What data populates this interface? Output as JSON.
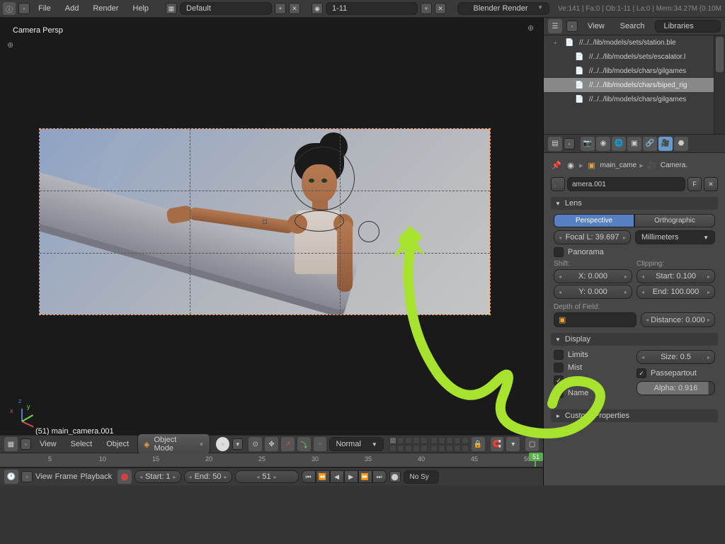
{
  "topbar": {
    "menus": [
      "File",
      "Add",
      "Render",
      "Help"
    ],
    "layout": "Default",
    "scene": "1-11",
    "renderer": "Blender Render",
    "stats": "Ve:141 | Fa:0 | Ob:1-11 | La:0 | Mem:34.27M (0.10M"
  },
  "viewport": {
    "persp_label": "Camera Persp",
    "object_label": "(51) main_camera.001",
    "header": {
      "menus": [
        "View",
        "Select",
        "Object"
      ],
      "mode": "Object Mode",
      "orientation": "Normal"
    }
  },
  "timeline": {
    "ticks": [
      5,
      10,
      15,
      20,
      25,
      30,
      35,
      40,
      45,
      50
    ],
    "current": 51,
    "footer": {
      "menus": [
        "View",
        "Frame",
        "Playback"
      ],
      "start_label": "Start: 1",
      "end_label": "End: 50",
      "current_label": "51",
      "sync": "No Sy"
    }
  },
  "outliner": {
    "menus": [
      "View",
      "Search"
    ],
    "source": "Libraries",
    "items": [
      {
        "text": "//../../lib/models/sets/station.ble",
        "expand": "+"
      },
      {
        "text": "//../../lib/models/sets/escalator.l",
        "expand": ""
      },
      {
        "text": "//../../lib/models/chars/gilgames",
        "expand": ""
      },
      {
        "text": "//../../lib/models/chars/biped_rig",
        "expand": "",
        "sel": true
      },
      {
        "text": "//../../lib/models/chars/gilgames",
        "expand": ""
      }
    ]
  },
  "props": {
    "breadcrumb": {
      "obj": "main_came",
      "data": "Camera."
    },
    "name": "amera.001",
    "fake": "F",
    "lens": {
      "title": "Lens",
      "perspective": "Perspective",
      "orthographic": "Orthographic",
      "focal": "Focal L: 39.697",
      "unit": "Millimeters",
      "panorama": "Panorama",
      "shift_label": "Shift:",
      "shift_x": "X: 0.000",
      "shift_y": "Y: 0.000",
      "clip_label": "Clipping:",
      "clip_start": "Start: 0.100",
      "clip_end": "End: 100.000",
      "dof_label": "Depth of Field:",
      "distance": "Distance: 0.000"
    },
    "display": {
      "title": "Display",
      "limits": "Limits",
      "mist": "Mist",
      "thirds": "Thirds",
      "name": "Name",
      "size": "Size: 0.5",
      "passepartout": "Passepartout",
      "alpha": "Alpha: 0.916"
    },
    "custom_title": "Custom Properties"
  }
}
